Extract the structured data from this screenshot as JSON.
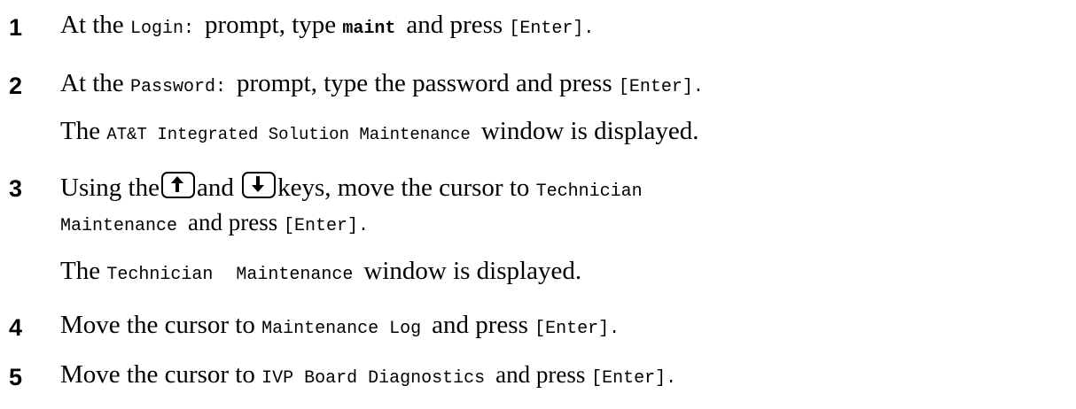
{
  "steps": [
    {
      "number": "1",
      "lines": [
        {
          "parts": [
            "At the ",
            "Login:",
            "prompt, type ",
            "maint",
            "and press ",
            "[Enter]."
          ]
        }
      ]
    },
    {
      "number": "2",
      "lines": [
        {
          "parts": [
            "At the ",
            "Password:",
            "prompt, type the password and press ",
            "[Enter]."
          ]
        },
        {
          "parts": [
            "The ",
            "AT&T Integrated Solution Maintenance",
            "window is displayed."
          ]
        }
      ]
    },
    {
      "number": "3",
      "lines": [
        {
          "parts": [
            "Using the",
            "and",
            "keys, move the cursor to ",
            "Technician"
          ]
        },
        {
          "parts": [
            "Maintenance",
            "and press ",
            "[Enter]."
          ]
        },
        {
          "parts": [
            "The ",
            "Technician Maintenance",
            "window is displayed."
          ]
        }
      ]
    },
    {
      "number": "4",
      "lines": [
        {
          "parts": [
            "Move the cursor to ",
            "Maintenance Log",
            "and press ",
            "[Enter]."
          ]
        }
      ]
    },
    {
      "number": "5",
      "lines": [
        {
          "parts": [
            "Move the cursor to ",
            "IVP Board Diagnostics",
            "and press ",
            "[Enter]."
          ]
        }
      ]
    }
  ],
  "keys": {
    "up": "up-arrow-key",
    "down": "down-arrow-key"
  }
}
